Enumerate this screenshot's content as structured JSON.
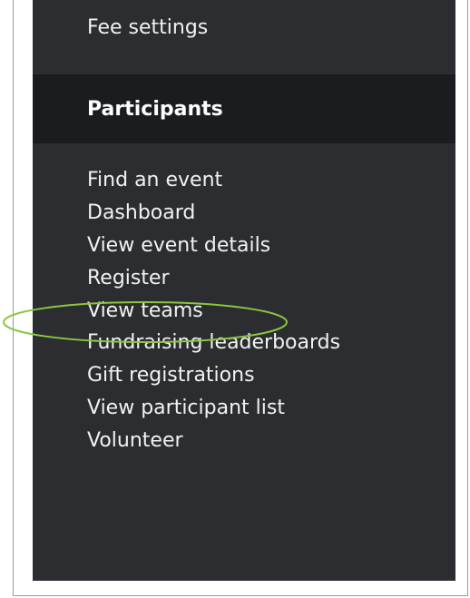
{
  "sidebar": {
    "cut_item_label": "Fee settings",
    "section_title": "Participants",
    "items": [
      {
        "label": "Find an event"
      },
      {
        "label": "Dashboard"
      },
      {
        "label": "View event details"
      },
      {
        "label": "Register"
      },
      {
        "label": "View teams"
      },
      {
        "label": "Fundraising leaderboards"
      },
      {
        "label": "Gift registrations"
      },
      {
        "label": "View participant list"
      },
      {
        "label": "Volunteer"
      }
    ]
  },
  "annotation": {
    "highlight_color": "#8cc63f",
    "target": "Register"
  },
  "colors": {
    "sidebar_bg": "#2b2d31",
    "section_header_bg": "#1b1c1f",
    "text": "#f2f2f2"
  }
}
